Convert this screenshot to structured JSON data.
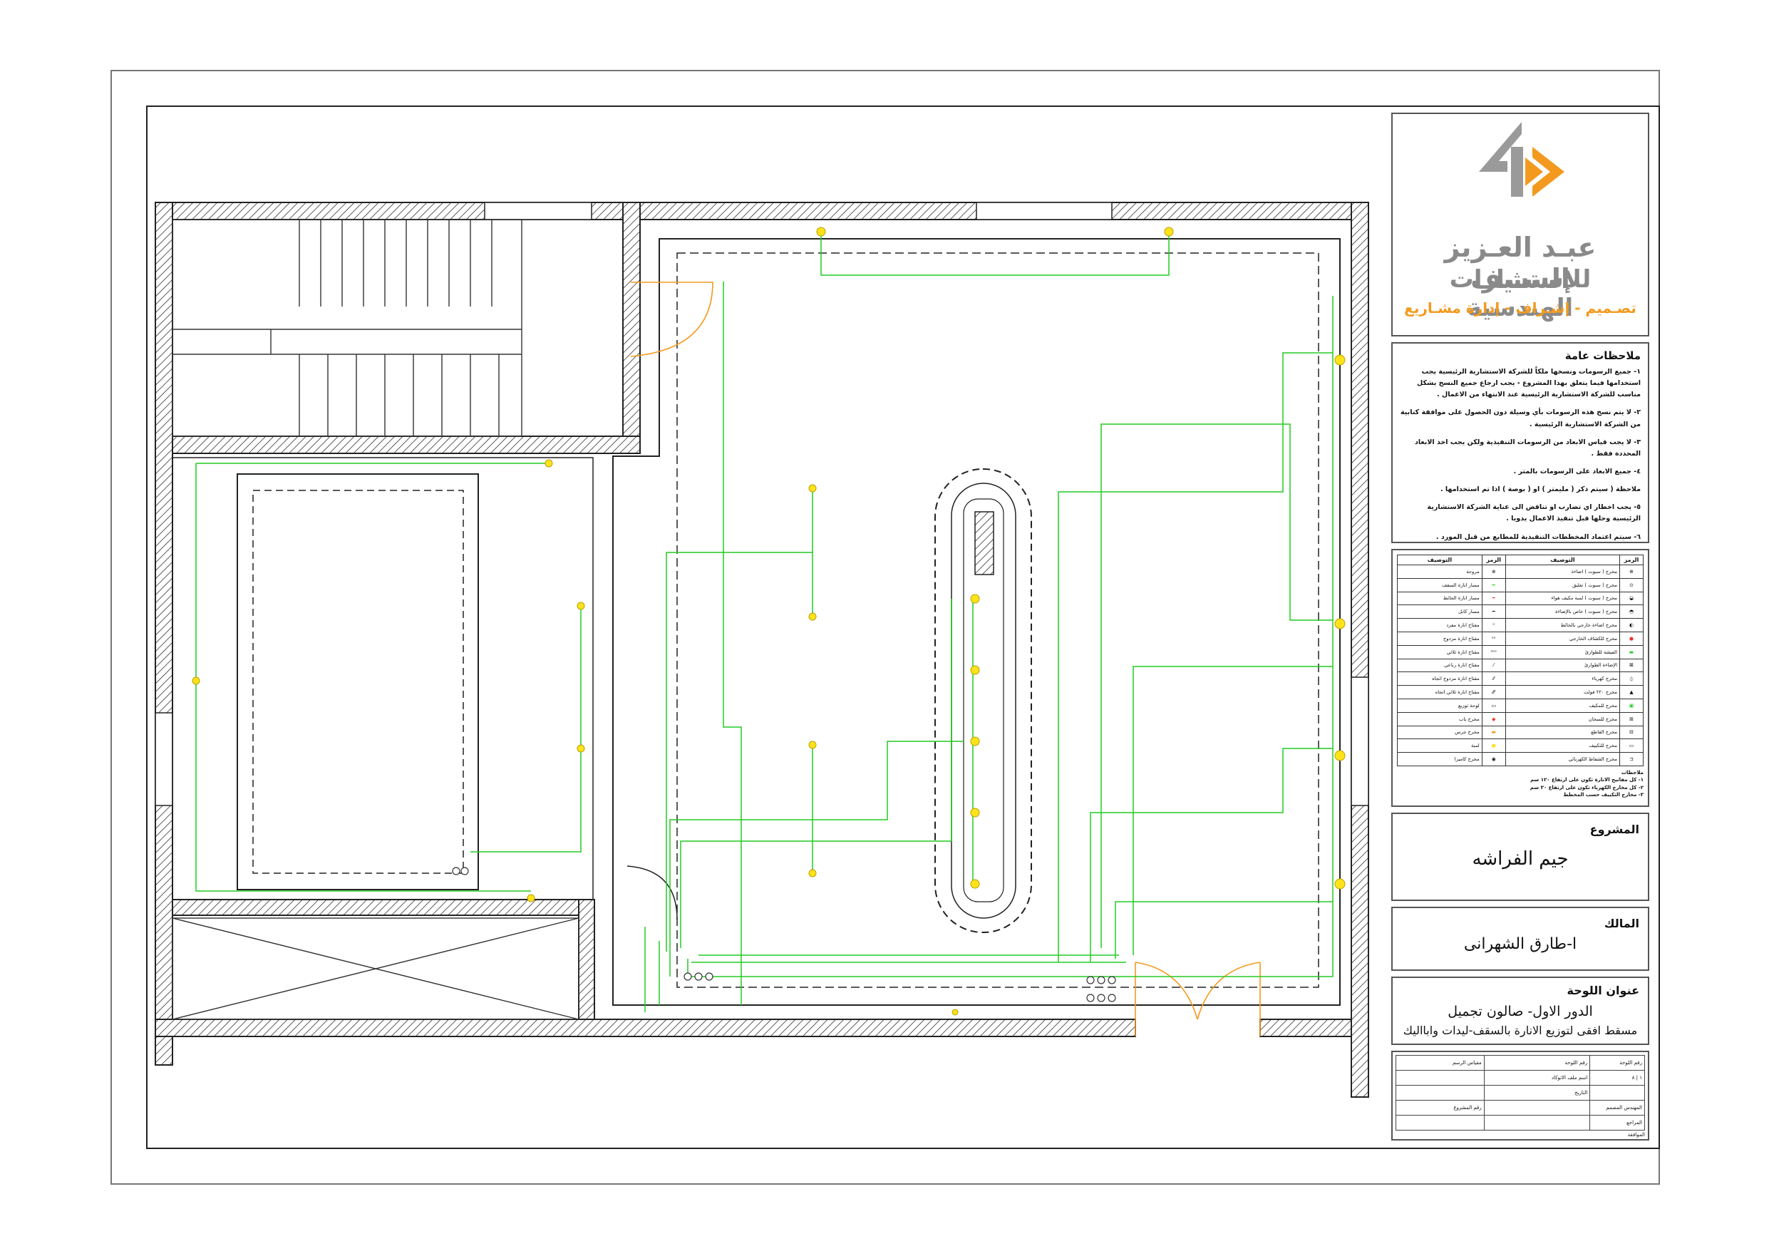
{
  "firm": {
    "name_line1": "عبـد العـزيز السـيف",
    "name_line2": "للإستشارات الهندسية",
    "tagline": "تصـميم - إشـراف - إدارة مشـاريع",
    "colors": {
      "accent": "#f39a1e",
      "grey": "#8a8a8a"
    }
  },
  "notes": {
    "title": "ملاحظات عامة",
    "items": [
      "١- جميع الرسومات ونسخها ملكاً للشركة الاستشارية الرئيسية يجب استخدامها فيما يتعلق بهذا المشروع - يجب ارجاع جميع النسخ بشكل مناسب للشركة الاستشارية الرئيسية عند الانتهاء من الاعمال .",
      "٢- لا يتم نسخ هذه الرسومات بأي وسيلة دون الحصول على موافقة كتابية من الشركة الاستشارية الرئيسية .",
      "٣- لا يجب قياس الابعاد من الرسومات التنفيذية ولكن يجب اخذ الابعاد المحددة فقط .",
      "٤- جميع الابعاد على الرسومات بالمتر .",
      "ملاحظة ( سيتم ذكر ( مليمتر ) او ( بوصة ) اذا تم استخدامها .",
      "٥- يجب اخطار اي تضارب او تناقض الى عناية الشركة الاستشارية الرئيسية وحلها قبل تنفيذ الاعمال يدويا .",
      "٦- سيتم اعتماد المخططات التنفيذية للمطابع من قبل المورد ."
    ]
  },
  "legend": {
    "headers": {
      "symbol": "الرمز",
      "desc": "التوصيف"
    },
    "right": [
      "مخرج ( سبوت ) اضاءة",
      "مخرج ( سبوت ) تعليق",
      "مخرج ( سبوت ) لمبة مكيف هواء",
      "مخرج ( سبوت ) خاص بالإضاءة",
      "مخرج اضاءة خارجي بالحائط",
      "مخرج للكشاف الخارجي",
      "الفيشة للطوارئ",
      "الإضاءة الطوارئ",
      "مخرج كهرباء",
      "مخرج ٢٢٠ فولت",
      "مخرج للمكيف",
      "مخرج للسخان",
      "مخرج القاطع",
      "مخرج للتكييف",
      "مخرج الشفاط الكهربائي"
    ],
    "left": [
      "مروحة",
      "مسار انارة السقف",
      "مسار انارة الحائط",
      "مسار كابل",
      "مفتاح انارة مفرد",
      "مفتاح انارة مزدوج",
      "مفتاح انارة ثلاثي",
      "مفتاح انارة رباعي",
      "مفتاح انارة مزدوج اتجاه",
      "مفتاح انارة ثلاثي اتجاه",
      "لوحة توزيع",
      "مخرج باب",
      "مخرج جرس",
      "لمبة",
      "مخرج كاميرا"
    ],
    "footnotes": [
      "ملاحظات",
      "١- كل مفاتيح الانارة تكون على ارتفاع ١٢٠ سم",
      "٢- كل مخارج الكهرباء تكون على ارتفاع ٣٠ سم",
      "٣- مخارج التكييف حسب المخطط"
    ]
  },
  "project": {
    "label": "المشروع",
    "value": "جيم الفراشه"
  },
  "owner": {
    "label": "المالك",
    "value": "ا-طارق الشهرانى"
  },
  "sheet": {
    "label": "عنوان اللوحة",
    "line1": "الدور الاول- صالون تجميل",
    "line2": "مسقط افقى لتوزيع الانارة بالسقف-ليدات وابااليك"
  },
  "meta": {
    "sheet_no_label": "رقم اللوحة",
    "scale_label": "مقياس الرسم",
    "sheet_no": "١ | ٨",
    "file_label": "اسم ملف الاتوكاد",
    "date_label": "التاريخ",
    "engineer_label": "المهندس المصمم",
    "project_no_label": "رقم المشروع",
    "review_label": "المراجع",
    "approval_label": "الموافقة"
  }
}
